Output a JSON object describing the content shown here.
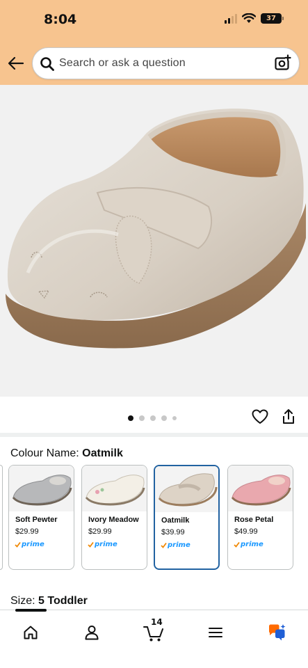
{
  "status_bar": {
    "time": "8:04",
    "battery": "37"
  },
  "search": {
    "placeholder": "Search or ask a question"
  },
  "carousel": {
    "dot_count": 5,
    "active_index": 0
  },
  "colour": {
    "label": "Colour Name:",
    "selected": "Oatmilk",
    "options": [
      {
        "name": "Soft Pewter",
        "price": "$29.99",
        "prime": "prime",
        "shoe_color": "#b7b8ba"
      },
      {
        "name": "Ivory Meadow",
        "price": "$29.99",
        "prime": "prime",
        "shoe_color": "#f3efe6"
      },
      {
        "name": "Oatmilk",
        "price": "$39.99",
        "prime": "prime",
        "shoe_color": "#ddd3c6"
      },
      {
        "name": "Rose Petal",
        "price": "$49.99",
        "prime": "prime",
        "shoe_color": "#e9a8ae"
      }
    ]
  },
  "size": {
    "label": "Size:",
    "selected": "5 Toddler"
  },
  "bottom_nav": {
    "cart_count": "14"
  },
  "colors": {
    "header_bg": "#f7c48f",
    "selected_border": "#2162a1",
    "prime_blue": "#1a98ff",
    "prime_check": "#f08804"
  }
}
